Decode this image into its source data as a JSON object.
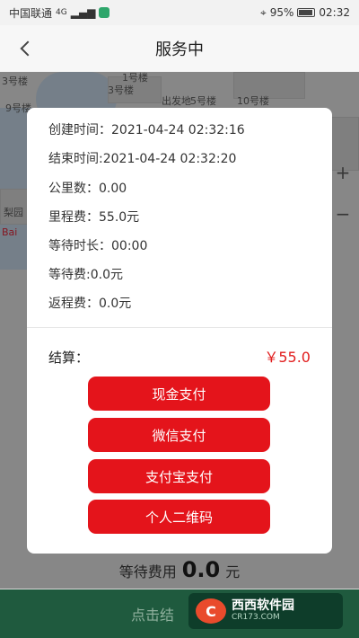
{
  "status_bar": {
    "carrier": "中国联通",
    "network": "4G",
    "battery": "95%",
    "time": "02:32"
  },
  "nav": {
    "title": "服务中",
    "back_icon": "chevron-left-icon"
  },
  "map": {
    "labels": [
      "3号楼",
      "1号楼",
      "3号楼",
      "9号楼",
      "出发地",
      "5号楼",
      "10号楼",
      "梨园",
      "Bai"
    ]
  },
  "order": {
    "rows": [
      {
        "label": "创建时间：",
        "value": "2021-04-24 02:32:16"
      },
      {
        "label": "结束时间:",
        "value": "2021-04-24 02:32:20"
      },
      {
        "label": "公里数：",
        "value": "0.00"
      },
      {
        "label": "里程费：",
        "value": "55.0元"
      },
      {
        "label": "等待时长：",
        "value": "00:00"
      },
      {
        "label": "等待费:",
        "value": "0.0元"
      },
      {
        "label": "返程费：",
        "value": "0.0元"
      }
    ],
    "total_label": "结算：",
    "total_value": "￥55.0"
  },
  "payment": {
    "buttons": [
      "现金支付",
      "微信支付",
      "支付宝支付",
      "个人二维码"
    ]
  },
  "bottom": {
    "wait_fee_label": "等待费用",
    "wait_fee_value": "0.0",
    "wait_fee_unit": "元",
    "action_label": "点击结"
  },
  "watermark": {
    "logo": "C",
    "title": "西西软件园",
    "subtitle": "CR173.COM"
  },
  "colors": {
    "accent_red": "#e4141b",
    "price_red": "#e11d1d",
    "bottom_green": "#1f5a3e"
  }
}
